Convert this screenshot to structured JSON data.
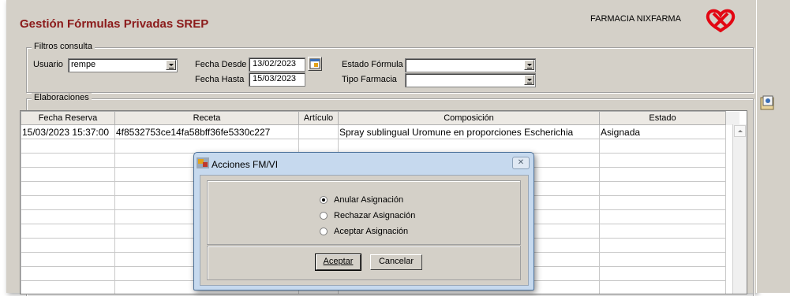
{
  "header": {
    "title": "Gestión Fórmulas Privadas SREP",
    "pharmacy": "FARMACIA NIXFARMA"
  },
  "filters": {
    "legend": "Filtros consulta",
    "usuario_label": "Usuario",
    "usuario_value": "rempe",
    "fecha_desde_label": "Fecha Desde",
    "fecha_desde_value": "13/02/2023",
    "fecha_hasta_label": "Fecha Hasta",
    "fecha_hasta_value": "15/03/2023",
    "estado_label": "Estado Fórmula",
    "estado_value": "",
    "tipo_label": "Tipo Farmacia",
    "tipo_value": ""
  },
  "elaboraciones": {
    "legend": "Elaboraciones",
    "columns": [
      "Fecha Reserva",
      "Receta",
      "Artículo",
      "Composición",
      "Estado"
    ],
    "rows": [
      [
        "15/03/2023 15:37:00",
        "4f8532753ce14fa58bff36fe5330c227",
        "",
        "Spray sublingual Uromune en proporciones Escherichia",
        "Asignada"
      ]
    ]
  },
  "dialog": {
    "title": "Acciones FM/VI",
    "close": "✕",
    "options": [
      {
        "label": "Anular Asignación",
        "selected": true
      },
      {
        "label": "Rechazar Asignación",
        "selected": false
      },
      {
        "label": "Aceptar Asignación",
        "selected": false
      }
    ],
    "accept": "Aceptar",
    "cancel": "Cancelar"
  },
  "colors": {
    "title": "#8b1a1a",
    "logo": "#e30613",
    "window_bg": "#d4d0c8"
  },
  "icons": {
    "calendar": "calendar-icon",
    "logo": "nixfarma-logo-icon",
    "side": "report-icon"
  }
}
